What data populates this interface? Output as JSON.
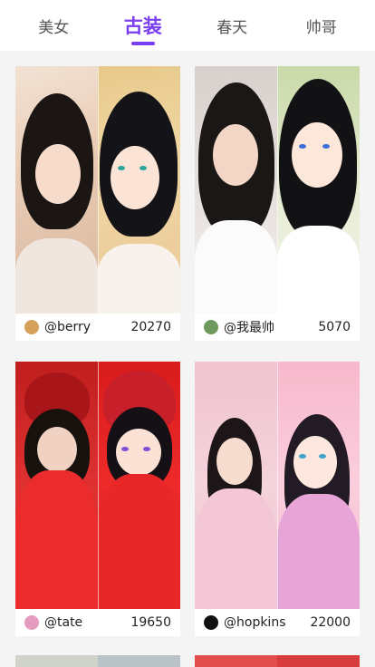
{
  "tabs": [
    {
      "label": "美女",
      "active": false
    },
    {
      "label": "古装",
      "active": true
    },
    {
      "label": "春天",
      "active": false
    },
    {
      "label": "帅哥",
      "active": false
    }
  ],
  "cards": [
    {
      "username": "@berry",
      "count": "20270",
      "avatar_color": "#d6a15a"
    },
    {
      "username": "@我最帅",
      "count": "5070",
      "avatar_color": "#6f9a5e"
    },
    {
      "username": "@tate",
      "count": "19650",
      "avatar_color": "#e59ac0"
    },
    {
      "username": "@hopkins",
      "count": "22000",
      "avatar_color": "#111111"
    }
  ],
  "colors": {
    "accent": "#7a3df0",
    "background": "#f4f4f4"
  }
}
